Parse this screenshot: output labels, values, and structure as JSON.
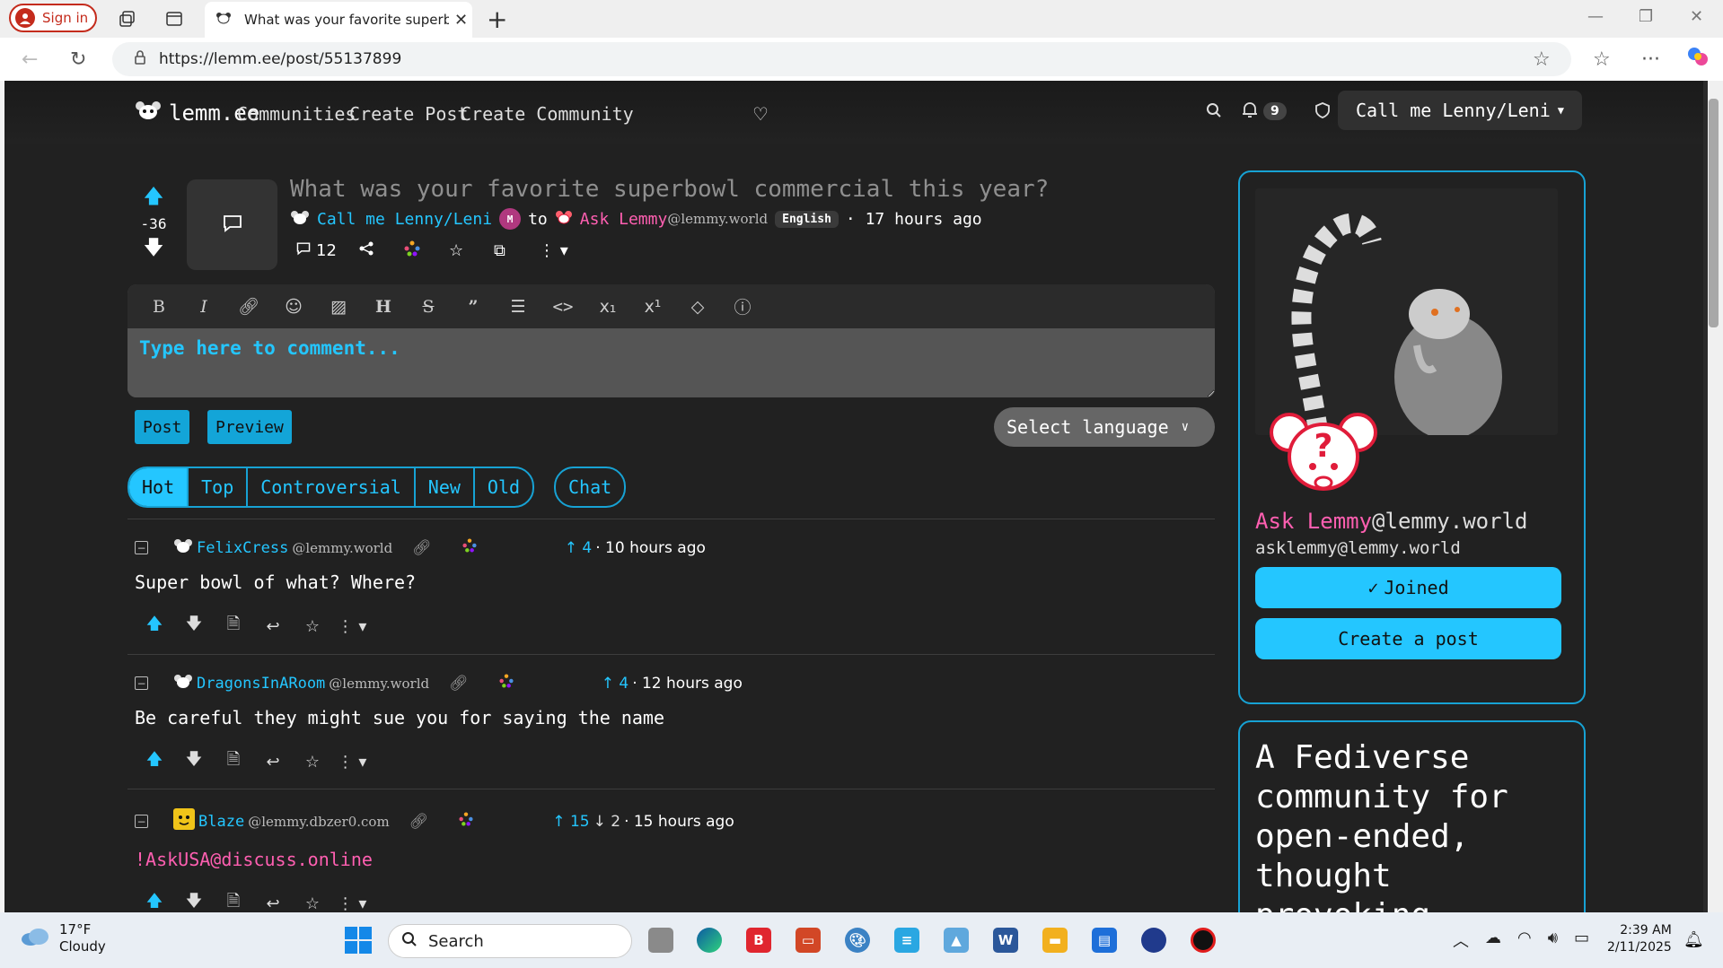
{
  "browser": {
    "signin_label": "Sign in",
    "tab_title": "What was your favorite superbow",
    "url": "https://lemm.ee/post/55137899"
  },
  "nav": {
    "brand": "lemm.ee",
    "links": [
      "Communities",
      "Create Post",
      "Create Community"
    ],
    "notif_count": "9",
    "user": "Call me Lenny/Leni"
  },
  "post": {
    "score": "-36",
    "title": "What was your favorite superbowl commercial this year?",
    "author": "Call me Lenny/Leni",
    "mod_badge": "M",
    "to": "to",
    "community": "Ask Lemmy",
    "community_instance": "@lemmy.world",
    "language": "English",
    "time": "· 17 hours ago",
    "comment_count": "12"
  },
  "editor": {
    "placeholder": "Type here to comment...",
    "post_label": "Post",
    "preview_label": "Preview",
    "select_language": "Select language"
  },
  "sort": {
    "options": [
      "Hot",
      "Top",
      "Controversial",
      "New",
      "Old"
    ],
    "chat": "Chat"
  },
  "comments": [
    {
      "user": "FelixCress",
      "instance": "@lemmy.world",
      "up": "4",
      "down": "",
      "time": "· 10 hours ago",
      "body": "Super bowl of what? Where?"
    },
    {
      "user": "DragonsInARoom",
      "instance": "@lemmy.world",
      "up": "4",
      "down": "",
      "time": "· 12 hours ago",
      "body": "Be careful they might sue you for saying the name"
    },
    {
      "user": "Blaze",
      "instance": "@lemmy.dbzer0.com",
      "up": "15",
      "down": "2",
      "time": "· 15 hours ago",
      "body": "!AskUSA@discuss.online"
    }
  ],
  "sidebar": {
    "community": "Ask Lemmy",
    "instance": "@lemmy.world",
    "handle": "asklemmy@lemmy.world",
    "joined_label": "Joined",
    "create_post_label": "Create a post",
    "description": "A Fediverse community for open-ended, thought provoking"
  },
  "taskbar": {
    "temp": "17°F",
    "weather": "Cloudy",
    "search": "Search",
    "time": "2:39 AM",
    "date": "2/11/2025"
  },
  "colors": {
    "accent": "#24c6ff",
    "pink": "#ff5fb1",
    "page_bg": "#212121"
  }
}
